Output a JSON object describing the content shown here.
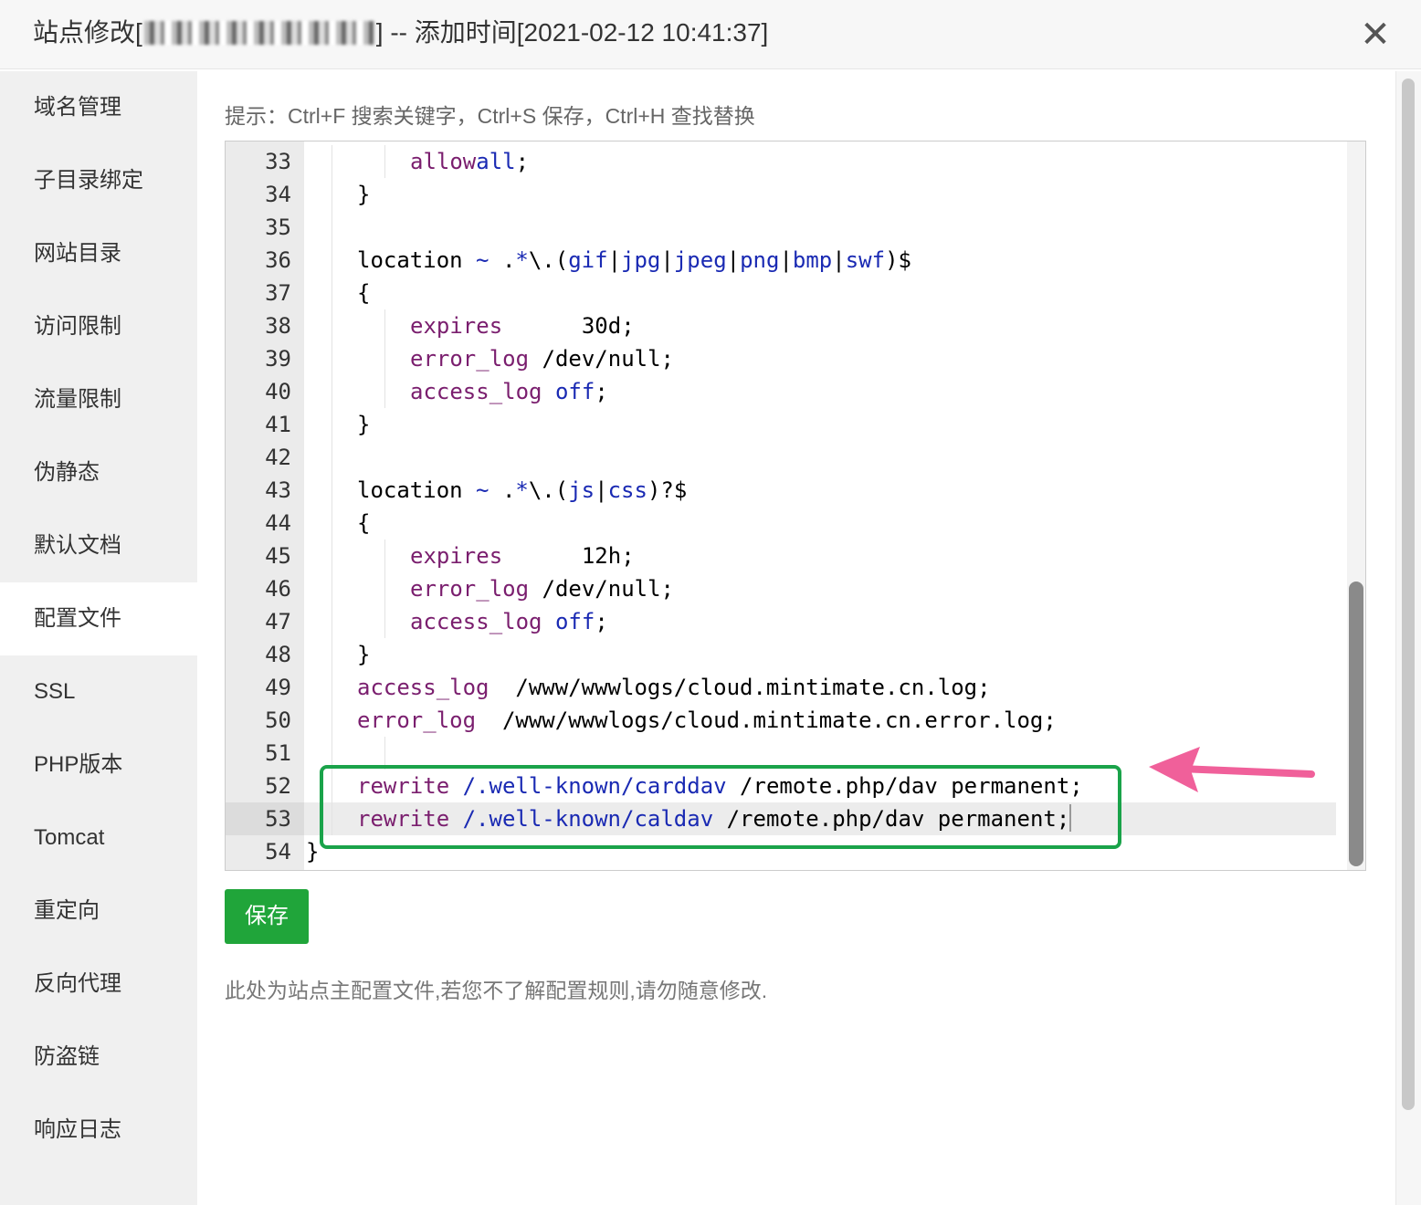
{
  "window": {
    "title_prefix": "站点修改[",
    "title_suffix": "] -- 添加时间[2021-02-12 10:41:37]",
    "close_label": "✕"
  },
  "sidebar": {
    "items": [
      {
        "label": "域名管理"
      },
      {
        "label": "子目录绑定"
      },
      {
        "label": "网站目录"
      },
      {
        "label": "访问限制"
      },
      {
        "label": "流量限制"
      },
      {
        "label": "伪静态"
      },
      {
        "label": "默认文档"
      },
      {
        "label": "配置文件"
      },
      {
        "label": "SSL"
      },
      {
        "label": "PHP版本"
      },
      {
        "label": "Tomcat"
      },
      {
        "label": "重定向"
      },
      {
        "label": "反向代理"
      },
      {
        "label": "防盗链"
      },
      {
        "label": "响应日志"
      }
    ],
    "active": "配置文件"
  },
  "main": {
    "tip": "提示：Ctrl+F 搜索关键字，Ctrl+S 保存，Ctrl+H 查找替换",
    "save_label": "保存",
    "note": "此处为站点主配置文件,若您不了解配置规则,请勿随意修改."
  },
  "editor": {
    "current_line": 53,
    "highlight_color": "#1aa34a",
    "arrow_color": "#f0609a",
    "lines": [
      {
        "n": "33",
        "depth": 2,
        "parts": [
          [
            "k",
            "allow"
          ],
          [
            "",
            "",
            " "
          ],
          [
            "v",
            "all"
          ],
          [
            "",
            ";"
          ]
        ]
      },
      {
        "n": "34",
        "depth": 1,
        "parts": [
          [
            "",
            "}"
          ]
        ]
      },
      {
        "n": "35",
        "depth": 1,
        "parts": []
      },
      {
        "n": "36",
        "depth": 1,
        "parts": [
          [
            "",
            "location "
          ],
          [
            "v",
            "~"
          ],
          [
            "",
            " ."
          ],
          [
            "v",
            "*"
          ],
          [
            "",
            "\\.("
          ],
          [
            "v",
            "gif"
          ],
          [
            "",
            "|"
          ],
          [
            "v",
            "jpg"
          ],
          [
            "",
            "|"
          ],
          [
            "v",
            "jpeg"
          ],
          [
            "",
            "|"
          ],
          [
            "v",
            "png"
          ],
          [
            "",
            "|"
          ],
          [
            "v",
            "bmp"
          ],
          [
            "",
            "|"
          ],
          [
            "v",
            "swf"
          ],
          [
            "",
            ")$"
          ]
        ]
      },
      {
        "n": "37",
        "depth": 1,
        "parts": [
          [
            "",
            "{"
          ]
        ]
      },
      {
        "n": "38",
        "depth": 2,
        "parts": [
          [
            "k",
            "expires"
          ],
          [
            "",
            "      30d;"
          ]
        ]
      },
      {
        "n": "39",
        "depth": 2,
        "parts": [
          [
            "k",
            "error_log"
          ],
          [
            "",
            " /dev/null;"
          ]
        ]
      },
      {
        "n": "40",
        "depth": 2,
        "parts": [
          [
            "k",
            "access_log"
          ],
          [
            "",
            " "
          ],
          [
            "v",
            "off"
          ],
          [
            "",
            ";"
          ]
        ]
      },
      {
        "n": "41",
        "depth": 1,
        "parts": [
          [
            "",
            "}"
          ]
        ]
      },
      {
        "n": "42",
        "depth": 1,
        "parts": []
      },
      {
        "n": "43",
        "depth": 1,
        "parts": [
          [
            "",
            "location "
          ],
          [
            "v",
            "~"
          ],
          [
            "",
            " ."
          ],
          [
            "v",
            "*"
          ],
          [
            "",
            "\\.("
          ],
          [
            "v",
            "js"
          ],
          [
            "",
            "|"
          ],
          [
            "v",
            "css"
          ],
          [
            "",
            ")?$"
          ]
        ]
      },
      {
        "n": "44",
        "depth": 1,
        "parts": [
          [
            "",
            "{"
          ]
        ]
      },
      {
        "n": "45",
        "depth": 2,
        "parts": [
          [
            "k",
            "expires"
          ],
          [
            "",
            "      12h;"
          ]
        ]
      },
      {
        "n": "46",
        "depth": 2,
        "parts": [
          [
            "k",
            "error_log"
          ],
          [
            "",
            " /dev/null;"
          ]
        ]
      },
      {
        "n": "47",
        "depth": 2,
        "parts": [
          [
            "k",
            "access_log"
          ],
          [
            "",
            " "
          ],
          [
            "v",
            "off"
          ],
          [
            "",
            ";"
          ]
        ]
      },
      {
        "n": "48",
        "depth": 1,
        "parts": [
          [
            "",
            "}"
          ]
        ]
      },
      {
        "n": "49",
        "depth": 1,
        "parts": [
          [
            "k",
            "access_log"
          ],
          [
            "",
            "  /www/wwwlogs/cloud.mintimate.cn.log;"
          ]
        ]
      },
      {
        "n": "50",
        "depth": 1,
        "parts": [
          [
            "k",
            "error_log"
          ],
          [
            "",
            "  /www/wwwlogs/cloud.mintimate.cn.error.log;"
          ]
        ]
      },
      {
        "n": "51",
        "depth": 2,
        "parts": []
      },
      {
        "n": "52",
        "depth": 1,
        "parts": [
          [
            "k",
            "rewrite"
          ],
          [
            "",
            " "
          ],
          [
            "v",
            "/.well-known/carddav"
          ],
          [
            "",
            " /remote.php/dav permanent;"
          ]
        ]
      },
      {
        "n": "53",
        "depth": 1,
        "parts": [
          [
            "k",
            "rewrite"
          ],
          [
            "",
            " "
          ],
          [
            "v",
            "/.well-known/caldav"
          ],
          [
            "",
            " /remote.php/dav permanent;"
          ]
        ]
      },
      {
        "n": "54",
        "depth": 0,
        "parts": [
          [
            "",
            "}"
          ]
        ]
      }
    ]
  }
}
